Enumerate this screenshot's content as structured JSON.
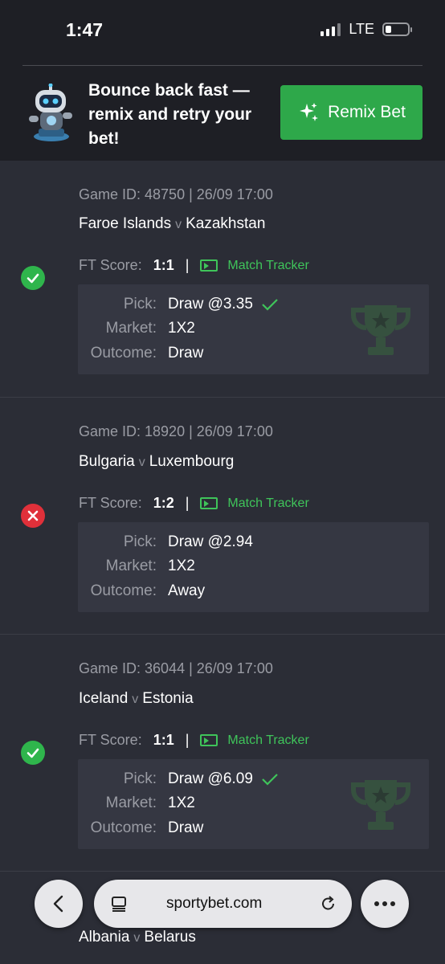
{
  "status_bar": {
    "time": "1:47",
    "network": "LTE"
  },
  "promo": {
    "text": "Bounce back fast — remix and retry your bet!",
    "button_label": "Remix Bet",
    "colors": {
      "button": "#2ea84a"
    }
  },
  "bets": [
    {
      "status": "won",
      "game_id": "Game ID: 48750 | 26/09 17:00",
      "home": "Faroe Islands",
      "vs": "v",
      "away": "Kazakhstan",
      "score_label": "FT Score:",
      "score": "1:1",
      "separator": "|",
      "tracker_label": "Match Tracker",
      "pick_label": "Pick:",
      "pick": "Draw @3.35",
      "market_label": "Market:",
      "market": "1X2",
      "outcome_label": "Outcome:",
      "outcome": "Draw"
    },
    {
      "status": "lost",
      "game_id": "Game ID: 18920 | 26/09 17:00",
      "home": "Bulgaria",
      "vs": "v",
      "away": "Luxembourg",
      "score_label": "FT Score:",
      "score": "1:2",
      "separator": "|",
      "tracker_label": "Match Tracker",
      "pick_label": "Pick:",
      "pick": "Draw @2.94",
      "market_label": "Market:",
      "market": "1X2",
      "outcome_label": "Outcome:",
      "outcome": "Away"
    },
    {
      "status": "won",
      "game_id": "Game ID: 36044 | 26/09 17:00",
      "home": "Iceland",
      "vs": "v",
      "away": "Estonia",
      "score_label": "FT Score:",
      "score": "1:1",
      "separator": "|",
      "tracker_label": "Match Tracker",
      "pick_label": "Pick:",
      "pick": "Draw @6.09",
      "market_label": "Market:",
      "market": "1X2",
      "outcome_label": "Outcome:",
      "outcome": "Draw"
    }
  ],
  "partial_bet": {
    "home": "Albania",
    "vs": "v",
    "away": "Belarus"
  },
  "browser": {
    "url": "sportybet.com"
  },
  "colors": {
    "won": "#2fb54c",
    "lost": "#e0303a",
    "accent": "#3fc45a",
    "background": "#2b2d36"
  }
}
